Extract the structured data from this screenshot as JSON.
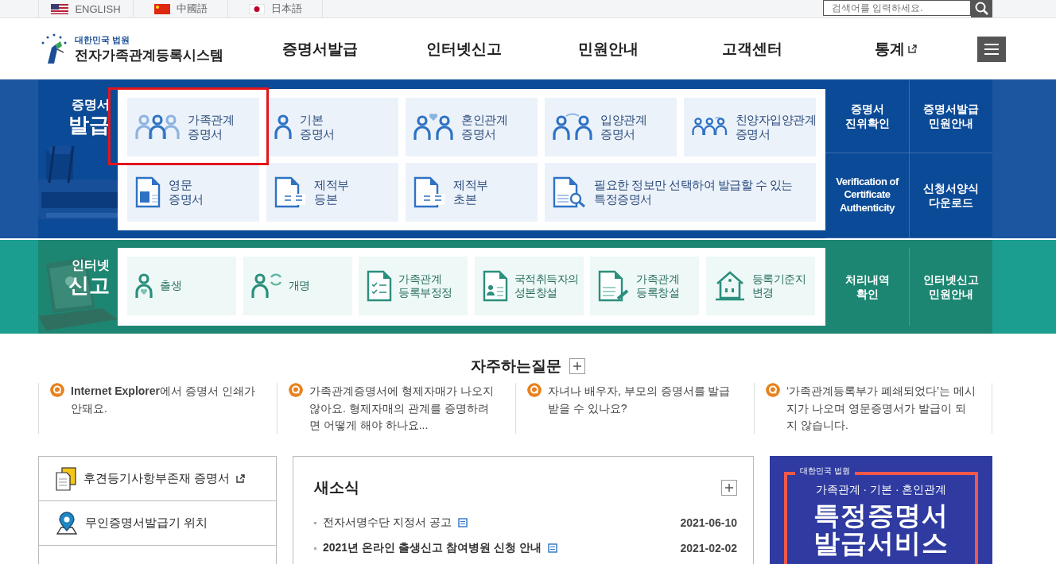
{
  "languages": [
    {
      "label": "ENGLISH"
    },
    {
      "label": "中國語"
    },
    {
      "label": "日本語"
    }
  ],
  "search": {
    "placeholder": "검색어를 입력하세요."
  },
  "logo": {
    "org": "대한민국 법원",
    "title": "전자가족관계등록시스템"
  },
  "nav": [
    {
      "label": "증명서발급",
      "external": false
    },
    {
      "label": "인터넷신고",
      "external": false
    },
    {
      "label": "민원안내",
      "external": false
    },
    {
      "label": "고객센터",
      "external": false
    },
    {
      "label": "통계",
      "external": true
    }
  ],
  "certificate_section": {
    "title_top": "증명서",
    "title_bottom": "발급",
    "tiles": [
      {
        "label": "가족관계\n증명서",
        "highlighted": true,
        "wide": false
      },
      {
        "label": "기본\n증명서",
        "highlighted": false,
        "wide": false
      },
      {
        "label": "혼인관계\n증명서",
        "highlighted": false,
        "wide": false
      },
      {
        "label": "입양관계\n증명서",
        "highlighted": false,
        "wide": false
      },
      {
        "label": "친양자입양관계\n증명서",
        "highlighted": false,
        "wide": false
      },
      {
        "label": "영문\n증명서",
        "highlighted": false,
        "wide": false
      },
      {
        "label": "제적부\n등본",
        "highlighted": false,
        "wide": false
      },
      {
        "label": "제적부\n초본",
        "highlighted": false,
        "wide": false
      },
      {
        "label": "필요한 정보만 선택하여 발급할 수 있는\n특정증명서",
        "highlighted": false,
        "wide": true
      }
    ],
    "links": [
      "증명서\n진위확인",
      "증명서발급\n민원안내",
      "Verification of\nCertificate\nAuthenticity",
      "신청서양식\n다운로드"
    ]
  },
  "report_section": {
    "title_top": "인터넷",
    "title_bottom": "신고",
    "tiles": [
      "출생",
      "개명",
      "가족관계\n등록부정정",
      "국적취득자의\n성본창설",
      "가족관계\n등록창설",
      "등록기준지\n변경"
    ],
    "links": [
      "처리내역\n확인",
      "인터넷신고\n민원안내"
    ]
  },
  "faq": {
    "title": "자주하는질문",
    "items": [
      "**Internet Explorer**에서 증명서 인쇄가 안돼요.",
      "가족관계증명서에 형제자매가 나오지 않아요. 형제자매의 관계를 증명하려면 어떻게 해야 하나요...",
      "자녀나 배우자, 부모의 증명서를 발급 받을 수 있나요?",
      "‘가족관계등록부가 폐쇄되었다’는 메시지가 나오며 영문증명서가 발급이 되지 않습니다."
    ]
  },
  "quick_links": [
    {
      "label": "후견등기사항부존재 증명서",
      "external": true
    },
    {
      "label": "무인증명서발급기 위치",
      "external": false
    }
  ],
  "news": {
    "title": "새소식",
    "items": [
      {
        "title": "전자서명수단 지정서 공고",
        "date": "2021-06-10"
      },
      {
        "title": "2021년 온라인 출생신고 참여병원 신청 안내",
        "date": "2021-02-02"
      }
    ]
  },
  "banner": {
    "org": "대한민국 법원",
    "subtitle": "가족관계 · 기본 · 혼인관계",
    "headline_1": "특정증명서",
    "headline_2": "발급서비스"
  }
}
